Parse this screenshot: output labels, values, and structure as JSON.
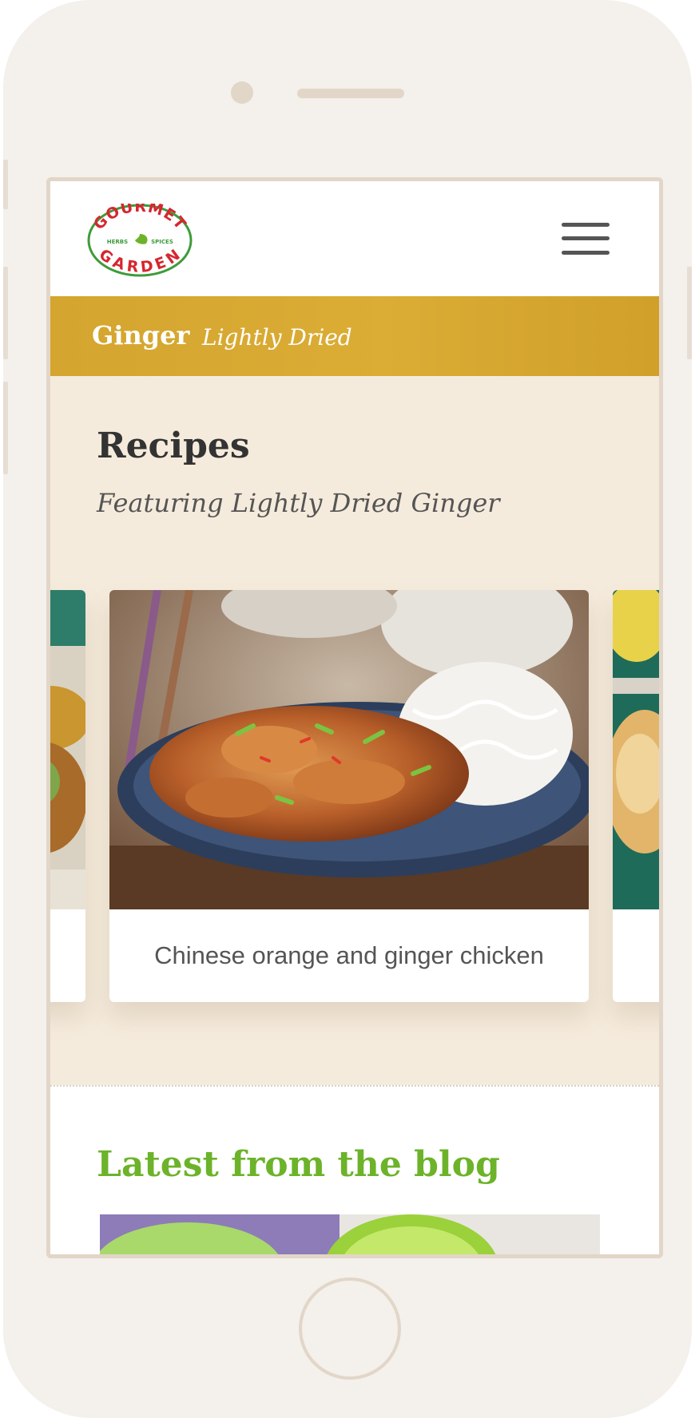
{
  "brand": {
    "logo_top": "GOURMET",
    "logo_middle_left": "HERBS",
    "logo_middle_right": "SPICES",
    "logo_bottom": "GARDEN",
    "logo_red": "#d6262f",
    "logo_green": "#3f9b3b"
  },
  "header": {
    "menu_icon": "hamburger-menu-icon"
  },
  "product_band": {
    "product": "Ginger",
    "variant": "Lightly Dried",
    "color": "#d8a832"
  },
  "recipes": {
    "title": "Recipes",
    "subtitle": "Featuring Lightly Dried Ginger",
    "background": "#f5ebdc",
    "cards": [
      {
        "caption": "Chinese orange and ginger chicken"
      }
    ]
  },
  "blog": {
    "title": "Latest from the blog",
    "title_color": "#6cb32a"
  }
}
